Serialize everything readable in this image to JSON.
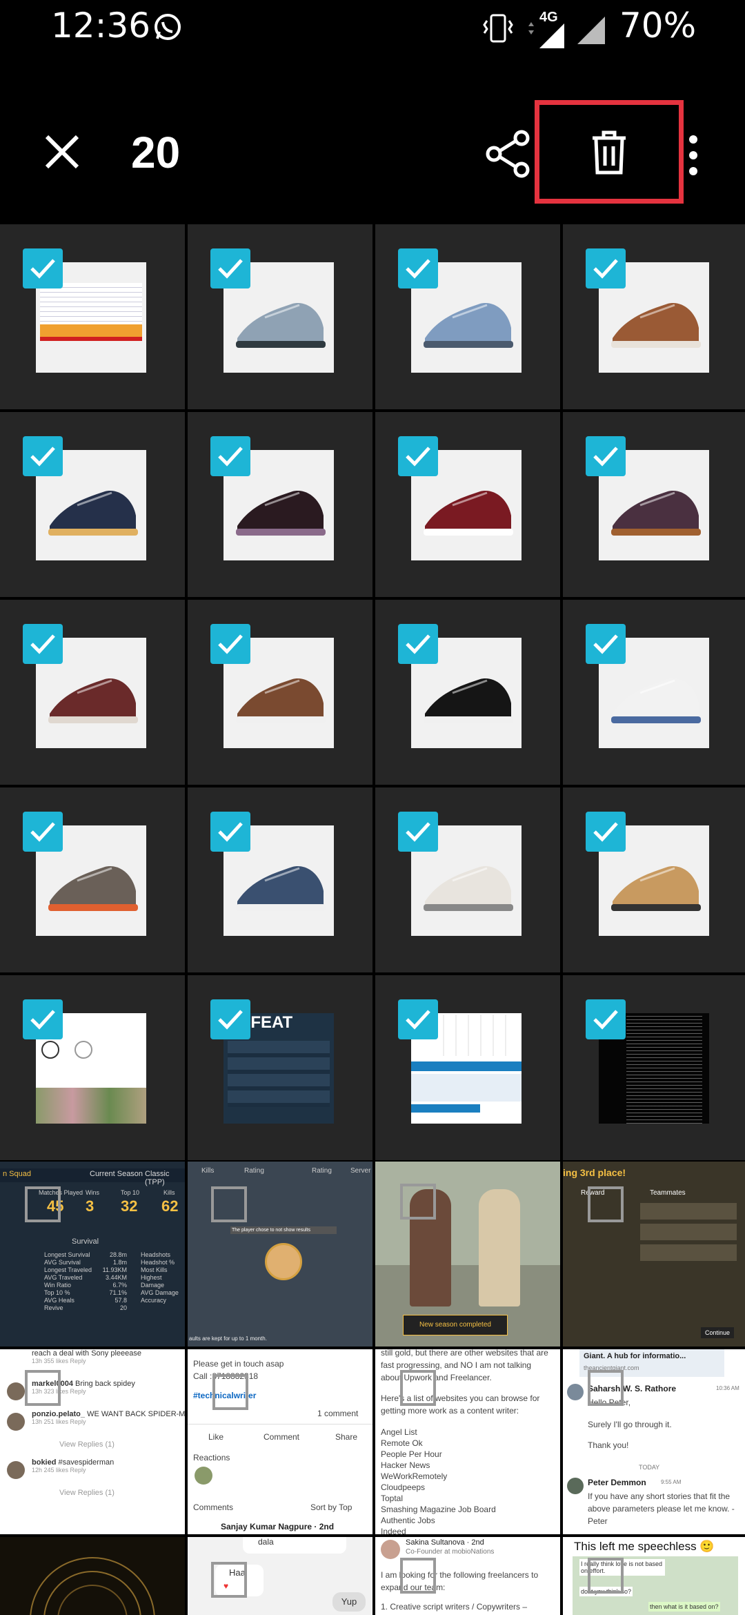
{
  "status": {
    "time": "12:36",
    "network": "4G",
    "battery": "70%"
  },
  "toolbar": {
    "selected_count": "20",
    "close_icon": "close-icon",
    "share_icon": "share-icon",
    "delete_icon": "trash-icon",
    "more_icon": "more-vert-icon",
    "highlight_color": "#e5333f"
  },
  "colors": {
    "check": "#1eb5d6",
    "cell_bg": "#262626"
  },
  "grid_rows": [
    [
      "doc",
      "shoe-grey",
      "shoe-blue-lace",
      "shoe-brown-high"
    ],
    [
      "shoe-navy",
      "shoe-slipon-print",
      "shoe-maroon",
      "shoe-knit"
    ],
    [
      "shoe-maroon-leather",
      "shoe-brown-loafer",
      "shoe-black-loafer",
      "shoe-white"
    ],
    [
      "shoe-grey-orange",
      "shoe-blue-knit",
      "shoe-white-dot",
      "shoe-tan"
    ],
    [
      "social-profile",
      "game-defeat",
      "checklist",
      "terminal"
    ]
  ],
  "game_row": {
    "stats": {
      "current_season": "Current Season",
      "classic": "Classic (TPP)",
      "watches_label": "Matches Played",
      "wins_label": "Wins",
      "top10_label": "Top 10",
      "kills_label": "Kills",
      "matches": "45",
      "wins": "3",
      "top10": "32",
      "kills": "62",
      "survival": "Survival",
      "lines": [
        "Longest Survival",
        "AVG Survival",
        "Longest Traveled",
        "AVG Traveled",
        "Win Ratio",
        "Top 10 %",
        "AVG Heals",
        "Revive"
      ],
      "values": [
        "28.8m",
        "1.8m",
        "11.93KM",
        "3.44KM",
        "6.7%",
        "71.1%",
        "57.8",
        "20"
      ],
      "right_lines": [
        "Headshots",
        "Headshot %",
        "Most Kills",
        "Highest Damage",
        "AVG Damage",
        "Accuracy"
      ]
    },
    "lobby": {
      "kills": "Kills",
      "rating": "Rating",
      "server": "Server",
      "note": "The player chose to not show results",
      "footer": "aults are kept for up to 1 month."
    },
    "squad_note": "New season completed",
    "ranking": {
      "title": "ing 3rd place!",
      "reward": "Reward",
      "teammates": "Teammates",
      "continue": "Continue"
    }
  },
  "doc_row": {
    "c1": {
      "lines": [
        {
          "user": "",
          "text": "reach a deal with Sony pleeease",
          "meta": "13h  355 likes  Reply"
        },
        {
          "user": "markel0004",
          "text": "Bring back spidey",
          "meta": "13h  323 likes  Reply"
        },
        {
          "user": "ponzio.pelato_",
          "text": "WE WANT BACK SPIDER-MAN",
          "meta": "13h  251 likes  Reply"
        },
        {
          "user": "",
          "text": "View Replies (1)",
          "meta": ""
        },
        {
          "user": "bokied",
          "text": "#savespiderman",
          "meta": "12h  245 likes  Reply"
        },
        {
          "user": "",
          "text": "View Replies (1)",
          "meta": ""
        }
      ]
    },
    "c2": {
      "l1": "Please get in touch asap",
      "l2": "Call :8718882318",
      "tag": "#technicalwriter",
      "comment_count": "1 comment",
      "like": "Like",
      "comment": "Comment",
      "share": "Share",
      "reactions": "Reactions",
      "comments": "Comments",
      "sort": "Sort by Top",
      "user": "Sanjay Kumar Nagpure · 2nd"
    },
    "c3": {
      "p1": "still gold, but there are other websites that are fast progressing, and NO I am not talking about Upwork and Freelancer.",
      "p2": "Here's a list of websites you can browse for getting more work as a content writer:",
      "items": [
        "Angel List",
        "Remote Ok",
        "People Per Hour",
        "Hacker News",
        "WeWorkRemotely",
        "Cloudpeeps",
        "Toptal",
        "Smashing Magazine Job Board",
        "Authentic Jobs",
        "Indeed"
      ]
    },
    "c4": {
      "link_title": "Giant. A hub for informatio...",
      "link_url": "theancientgiant.com",
      "user1": "Saharsh W. S. Rathore",
      "time1": "10:36 AM",
      "m1": "Hello Peter,",
      "m2": "Surely I'll go through it.",
      "m3": "Thank you!",
      "today": "TODAY",
      "user2": "Peter Demmon",
      "time2": "9:55 AM",
      "m4": "If you have any short stories that fit the above parameters please let me know. -Peter"
    }
  },
  "last_row": {
    "c2_top": "dala",
    "c2_a": "Haa",
    "c2_b": "Yup",
    "c3_user": "Sakina Sultanova · 2nd",
    "c3_role": "Co-Founder at mobioNations",
    "c3_text": "I am looking for the following freelancers to expand our team:",
    "c3_item": "1. Creative script writers / Copywriters –",
    "c4_title": "This left me speechless 🙂",
    "c4_b1": "I really think love is not based on effort.",
    "c4_b2": "dont you think so?",
    "c4_b3": "then what is it based on?"
  }
}
